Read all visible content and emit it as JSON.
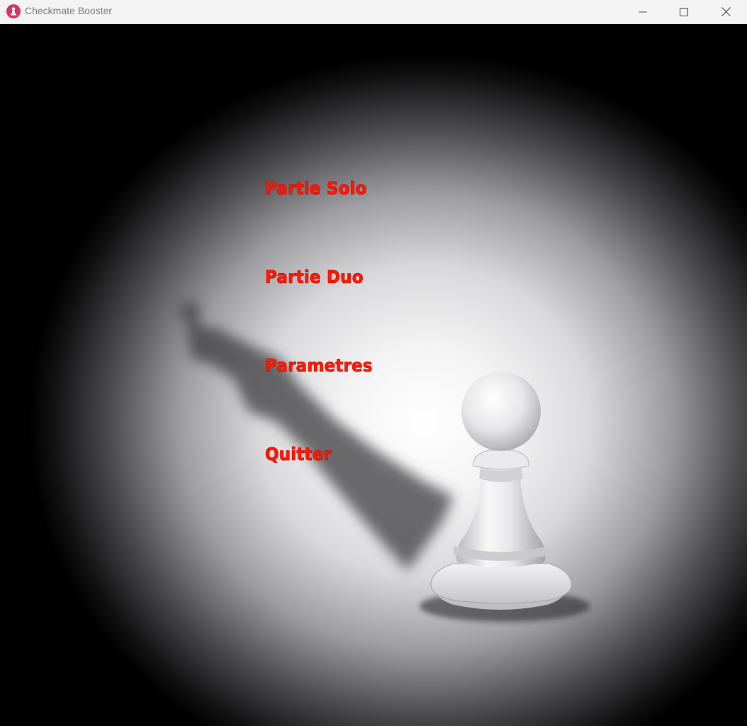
{
  "window": {
    "title": "Checkmate Booster",
    "icon": "chess-pawn-app-icon",
    "controls": [
      "minimize",
      "maximize",
      "close"
    ]
  },
  "menu": {
    "solo_label": "Partie Solo",
    "duo_label": "Partie Duo",
    "settings_label": "Parametres",
    "quit_label": "Quitter"
  },
  "colors": {
    "menu_text": "#ff1a00",
    "titlebar": "#f3f3f3",
    "app_icon": "#d6336c"
  }
}
